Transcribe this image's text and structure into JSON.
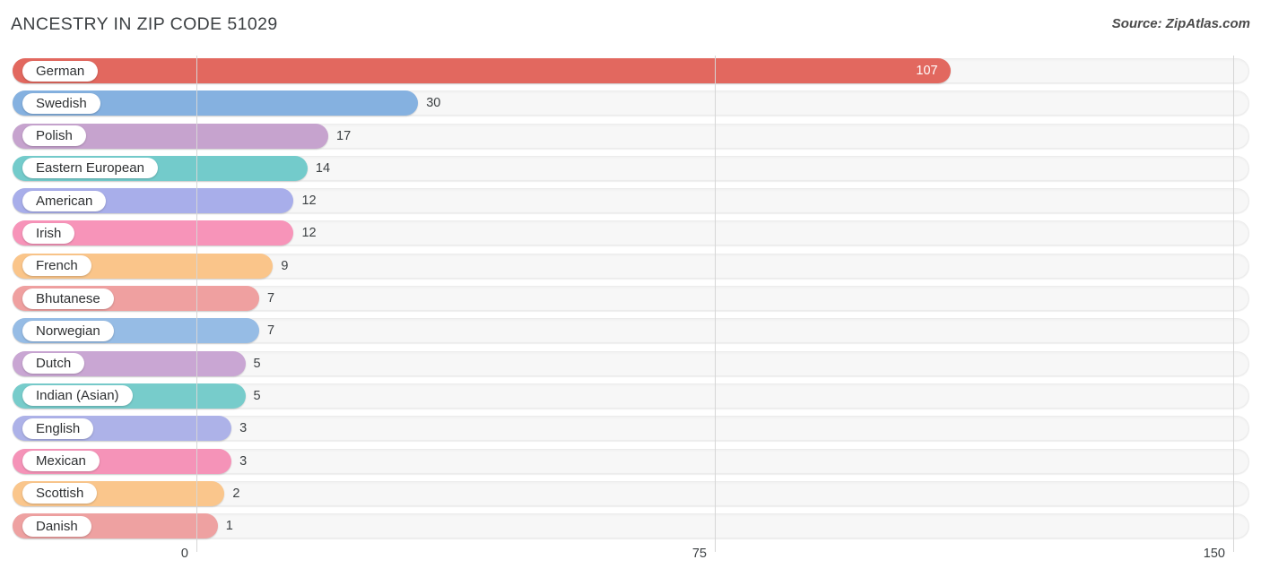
{
  "header": {
    "title": "ANCESTRY IN ZIP CODE 51029",
    "source": "Source: ZipAtlas.com"
  },
  "axis": {
    "ticks": [
      "0",
      "75",
      "150"
    ]
  },
  "chart_data": {
    "type": "bar",
    "orientation": "horizontal",
    "title": "ANCESTRY IN ZIP CODE 51029",
    "xlabel": "",
    "ylabel": "",
    "xlim": [
      0,
      150
    ],
    "xticks": [
      0,
      75,
      150
    ],
    "grid": true,
    "legend": false,
    "source": "Source: ZipAtlas.com",
    "categories": [
      "German",
      "Swedish",
      "Polish",
      "Eastern European",
      "American",
      "Irish",
      "French",
      "Bhutanese",
      "Norwegian",
      "Dutch",
      "Indian (Asian)",
      "English",
      "Mexican",
      "Scottish",
      "Danish"
    ],
    "values": [
      107,
      30,
      17,
      14,
      12,
      12,
      9,
      7,
      7,
      5,
      5,
      3,
      3,
      2,
      1
    ],
    "colors": [
      "#e2685f",
      "#85b1e0",
      "#c6a3ce",
      "#73cbcb",
      "#a8aeea",
      "#f794b9",
      "#fac58a",
      "#efa0a0",
      "#96bce5",
      "#c9a6d3",
      "#77cccb",
      "#adb2e8",
      "#f593b8",
      "#fac68c",
      "#eea1a1"
    ],
    "value_labels": [
      "107",
      "30",
      "17",
      "14",
      "12",
      "12",
      "9",
      "7",
      "7",
      "5",
      "5",
      "3",
      "3",
      "2",
      "1"
    ],
    "label_inside": [
      true,
      false,
      false,
      false,
      false,
      false,
      false,
      false,
      false,
      false,
      false,
      false,
      false,
      false,
      false
    ]
  }
}
